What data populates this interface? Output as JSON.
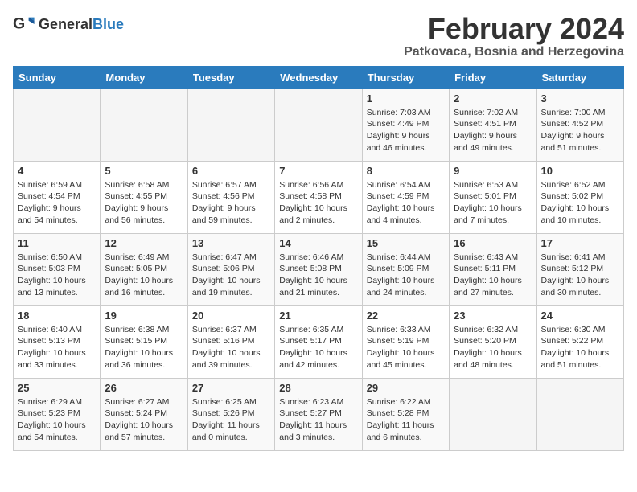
{
  "header": {
    "logo_general": "General",
    "logo_blue": "Blue",
    "month_title": "February 2024",
    "location": "Patkovaca, Bosnia and Herzegovina"
  },
  "weekdays": [
    "Sunday",
    "Monday",
    "Tuesday",
    "Wednesday",
    "Thursday",
    "Friday",
    "Saturday"
  ],
  "weeks": [
    [
      {
        "day": "",
        "info": ""
      },
      {
        "day": "",
        "info": ""
      },
      {
        "day": "",
        "info": ""
      },
      {
        "day": "",
        "info": ""
      },
      {
        "day": "1",
        "info": "Sunrise: 7:03 AM\nSunset: 4:49 PM\nDaylight: 9 hours\nand 46 minutes."
      },
      {
        "day": "2",
        "info": "Sunrise: 7:02 AM\nSunset: 4:51 PM\nDaylight: 9 hours\nand 49 minutes."
      },
      {
        "day": "3",
        "info": "Sunrise: 7:00 AM\nSunset: 4:52 PM\nDaylight: 9 hours\nand 51 minutes."
      }
    ],
    [
      {
        "day": "4",
        "info": "Sunrise: 6:59 AM\nSunset: 4:54 PM\nDaylight: 9 hours\nand 54 minutes."
      },
      {
        "day": "5",
        "info": "Sunrise: 6:58 AM\nSunset: 4:55 PM\nDaylight: 9 hours\nand 56 minutes."
      },
      {
        "day": "6",
        "info": "Sunrise: 6:57 AM\nSunset: 4:56 PM\nDaylight: 9 hours\nand 59 minutes."
      },
      {
        "day": "7",
        "info": "Sunrise: 6:56 AM\nSunset: 4:58 PM\nDaylight: 10 hours\nand 2 minutes."
      },
      {
        "day": "8",
        "info": "Sunrise: 6:54 AM\nSunset: 4:59 PM\nDaylight: 10 hours\nand 4 minutes."
      },
      {
        "day": "9",
        "info": "Sunrise: 6:53 AM\nSunset: 5:01 PM\nDaylight: 10 hours\nand 7 minutes."
      },
      {
        "day": "10",
        "info": "Sunrise: 6:52 AM\nSunset: 5:02 PM\nDaylight: 10 hours\nand 10 minutes."
      }
    ],
    [
      {
        "day": "11",
        "info": "Sunrise: 6:50 AM\nSunset: 5:03 PM\nDaylight: 10 hours\nand 13 minutes."
      },
      {
        "day": "12",
        "info": "Sunrise: 6:49 AM\nSunset: 5:05 PM\nDaylight: 10 hours\nand 16 minutes."
      },
      {
        "day": "13",
        "info": "Sunrise: 6:47 AM\nSunset: 5:06 PM\nDaylight: 10 hours\nand 19 minutes."
      },
      {
        "day": "14",
        "info": "Sunrise: 6:46 AM\nSunset: 5:08 PM\nDaylight: 10 hours\nand 21 minutes."
      },
      {
        "day": "15",
        "info": "Sunrise: 6:44 AM\nSunset: 5:09 PM\nDaylight: 10 hours\nand 24 minutes."
      },
      {
        "day": "16",
        "info": "Sunrise: 6:43 AM\nSunset: 5:11 PM\nDaylight: 10 hours\nand 27 minutes."
      },
      {
        "day": "17",
        "info": "Sunrise: 6:41 AM\nSunset: 5:12 PM\nDaylight: 10 hours\nand 30 minutes."
      }
    ],
    [
      {
        "day": "18",
        "info": "Sunrise: 6:40 AM\nSunset: 5:13 PM\nDaylight: 10 hours\nand 33 minutes."
      },
      {
        "day": "19",
        "info": "Sunrise: 6:38 AM\nSunset: 5:15 PM\nDaylight: 10 hours\nand 36 minutes."
      },
      {
        "day": "20",
        "info": "Sunrise: 6:37 AM\nSunset: 5:16 PM\nDaylight: 10 hours\nand 39 minutes."
      },
      {
        "day": "21",
        "info": "Sunrise: 6:35 AM\nSunset: 5:17 PM\nDaylight: 10 hours\nand 42 minutes."
      },
      {
        "day": "22",
        "info": "Sunrise: 6:33 AM\nSunset: 5:19 PM\nDaylight: 10 hours\nand 45 minutes."
      },
      {
        "day": "23",
        "info": "Sunrise: 6:32 AM\nSunset: 5:20 PM\nDaylight: 10 hours\nand 48 minutes."
      },
      {
        "day": "24",
        "info": "Sunrise: 6:30 AM\nSunset: 5:22 PM\nDaylight: 10 hours\nand 51 minutes."
      }
    ],
    [
      {
        "day": "25",
        "info": "Sunrise: 6:29 AM\nSunset: 5:23 PM\nDaylight: 10 hours\nand 54 minutes."
      },
      {
        "day": "26",
        "info": "Sunrise: 6:27 AM\nSunset: 5:24 PM\nDaylight: 10 hours\nand 57 minutes."
      },
      {
        "day": "27",
        "info": "Sunrise: 6:25 AM\nSunset: 5:26 PM\nDaylight: 11 hours\nand 0 minutes."
      },
      {
        "day": "28",
        "info": "Sunrise: 6:23 AM\nSunset: 5:27 PM\nDaylight: 11 hours\nand 3 minutes."
      },
      {
        "day": "29",
        "info": "Sunrise: 6:22 AM\nSunset: 5:28 PM\nDaylight: 11 hours\nand 6 minutes."
      },
      {
        "day": "",
        "info": ""
      },
      {
        "day": "",
        "info": ""
      }
    ]
  ]
}
